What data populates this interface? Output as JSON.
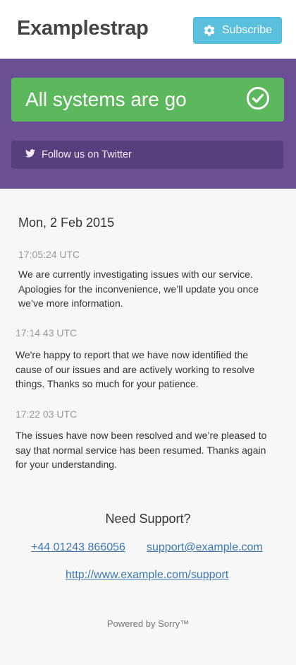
{
  "header": {
    "brand": "Examplestrap",
    "subscribe_label": "Subscribe",
    "subscribe_icon": "gear-icon"
  },
  "status": {
    "text": "All systems are go",
    "icon": "check-circle-icon",
    "twitter_label": "Follow us on Twitter",
    "twitter_icon": "twitter-icon"
  },
  "timeline": {
    "date": "Mon, 2 Feb 2015",
    "updates": [
      {
        "time": "17:05:24 UTC",
        "lines": [
          "We are currently investigating issues with our service.",
          "Apologies for the inconvenience, we’ll update you once",
          "we’ve more information."
        ]
      },
      {
        "time": "17:14 43 UTC",
        "lines": [
          "We're happy to report that we have now identified the",
          "cause of our issues and are actively working to resolve",
          "things. Thanks so much for your patience."
        ]
      },
      {
        "time": "17:22 03 UTC",
        "lines": [
          "The issues have now been resolved and we’re pleased to",
          "say that normal service has been  resumed. Thanks again",
          "for your understanding."
        ]
      }
    ]
  },
  "support": {
    "title": "Need Support?",
    "phone": "+44 01243 866056",
    "email": "support@example.com",
    "url": "http://www.example.com/support"
  },
  "footer": {
    "powered": "Powered by Sorry™"
  },
  "colors": {
    "banner": "#6a4f94",
    "status_ok": "#5cb85c",
    "subscribe": "#5bc0de",
    "link": "#3c78b5"
  }
}
